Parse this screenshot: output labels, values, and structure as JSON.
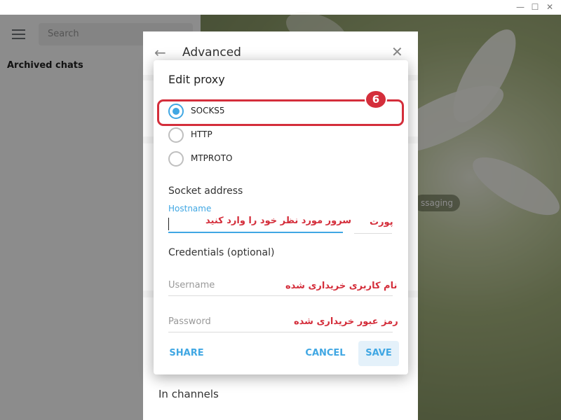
{
  "window": {
    "minimize": "—",
    "maximize": "☐",
    "close": "✕"
  },
  "sidebar": {
    "search_placeholder": "Search",
    "archived_label": "Archived chats"
  },
  "background": {
    "pill_text": "ssaging"
  },
  "advanced": {
    "title": "Advanced",
    "in_channels": "In channels"
  },
  "dialog": {
    "title": "Edit proxy",
    "step_badge": "6",
    "proxy_types": [
      {
        "label": "SOCKS5",
        "selected": true
      },
      {
        "label": "HTTP",
        "selected": false
      },
      {
        "label": "MTPROTO",
        "selected": false
      }
    ],
    "socket_section": "Socket address",
    "hostname_label": "Hostname",
    "hostname_hint": "سرور مورد نظر خود را وارد کنید",
    "port_hint": "پورت",
    "credentials_section": "Credentials (optional)",
    "username_placeholder": "Username",
    "username_hint": "نام کاربری خریداری شده",
    "password_placeholder": "Password",
    "password_hint": "رمز عبور خریداری شده",
    "buttons": {
      "share": "SHARE",
      "cancel": "CANCEL",
      "save": "SAVE"
    }
  },
  "colors": {
    "accent": "#40a7e3",
    "annotation_red": "#d42e3b"
  }
}
